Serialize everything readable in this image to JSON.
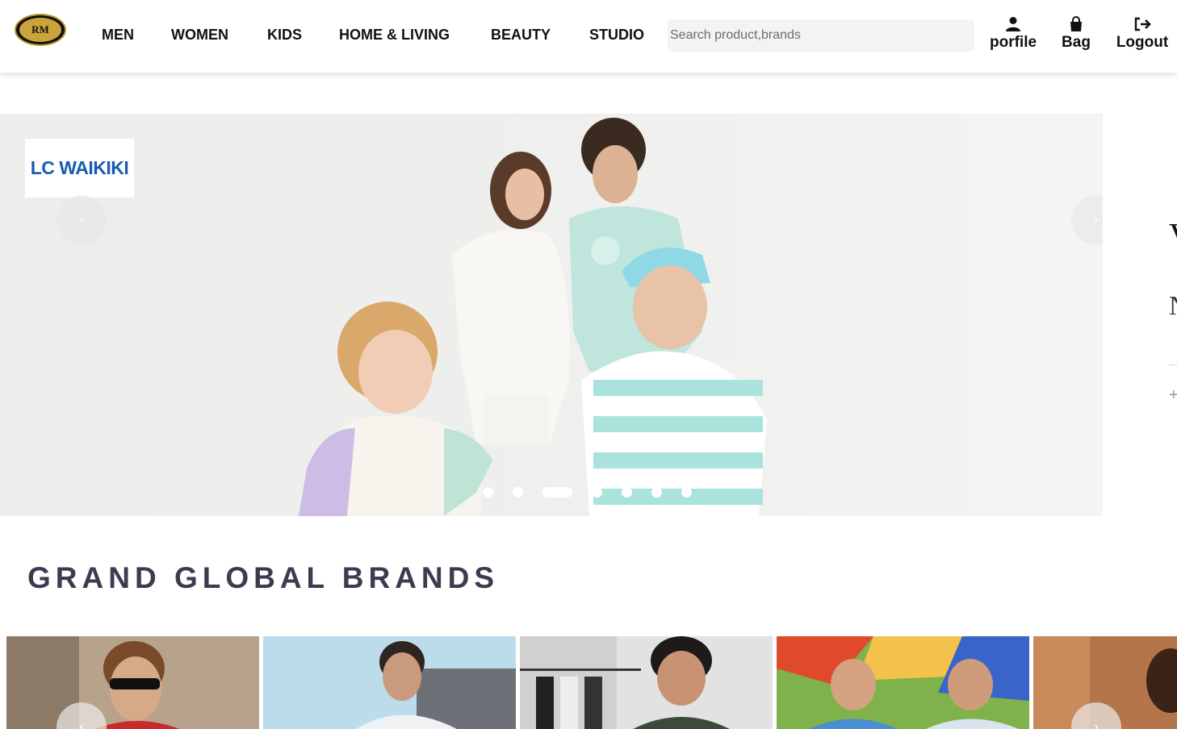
{
  "header": {
    "logo_text": "RM",
    "nav": [
      "MEN",
      "WOMEN",
      "KIDS",
      "HOME & LIVING",
      "BEAUTY",
      "STUDIO"
    ],
    "search_placeholder": "Search product,brands",
    "actions": [
      {
        "label": "porfile",
        "icon": "user-icon"
      },
      {
        "label": "Bag",
        "icon": "shopping-bag-icon"
      },
      {
        "label": "Logout",
        "icon": "logout-icon"
      }
    ]
  },
  "hero": {
    "brand_logo": "LC WAIKIKI",
    "prev_icon": "‹",
    "next_icon": "›",
    "slide_count": 7,
    "active_slide": 3,
    "next_slide_text": [
      "V",
      "N",
      "+"
    ]
  },
  "section": {
    "title": "GRAND GLOBAL BRANDS"
  },
  "colors": {
    "title": "#3b3c4f",
    "lcwaikiki_blue": "#1a5bb0",
    "search_bg": "#f3f3f3"
  },
  "brand_cards": [
    "brand-card-1",
    "brand-card-2",
    "brand-card-3",
    "brand-card-4",
    "brand-card-5"
  ]
}
